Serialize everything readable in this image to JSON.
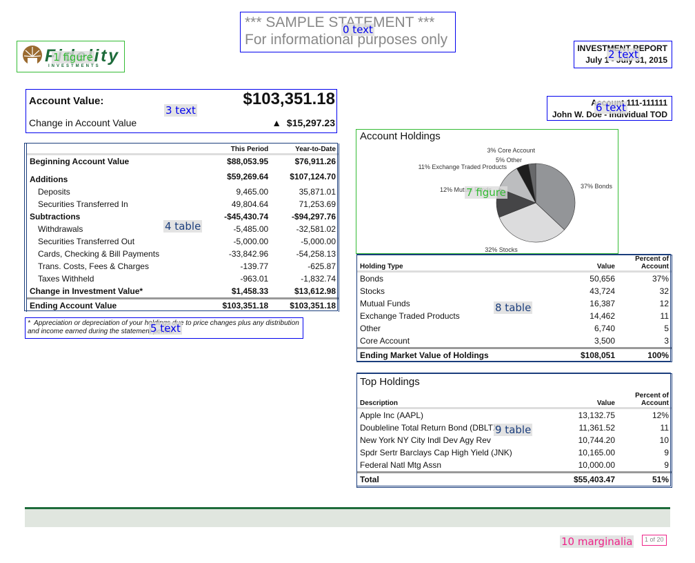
{
  "header": {
    "sample_line1": "*** SAMPLE STATEMENT ***",
    "sample_line2": "For informational purposes only",
    "report_title": "INVESTMENT REPORT",
    "report_period": "July 1 - July 31, 2015",
    "account_number": "Account 111-111111",
    "account_holder": "John W. Doe - Individual TOD",
    "logo_text": "Fidelity",
    "logo_sub": "INVESTMENTS"
  },
  "account_value": {
    "label": "Account Value:",
    "value": "$103,351.18",
    "change_label": "Change in Account Value",
    "change_arrow": "▲",
    "change_value": "$15,297.23"
  },
  "summary": {
    "columns": [
      "This Period",
      "Year-to-Date"
    ],
    "rows": [
      {
        "label": "Beginning Account Value",
        "p": "$88,053.95",
        "y": "$76,911.26"
      },
      {
        "label": "Additions",
        "p": "$59,269.64",
        "y": "$107,124.70"
      },
      {
        "label": "Deposits",
        "p": "9,465.00",
        "y": "35,871.01"
      },
      {
        "label": "Securities Transferred In",
        "p": "49,804.64",
        "y": "71,253.69"
      },
      {
        "label": "Subtractions",
        "p": "-$45,430.74",
        "y": "-$94,297.76"
      },
      {
        "label": "Withdrawals",
        "p": "-5,485.00",
        "y": "-32,581.02"
      },
      {
        "label": "Securities Transferred Out",
        "p": "-5,000.00",
        "y": "-5,000.00"
      },
      {
        "label": "Cards, Checking & Bill Payments",
        "p": "-33,842.96",
        "y": "-54,258.13"
      },
      {
        "label": "Trans. Costs, Fees & Charges",
        "p": "-139.77",
        "y": "-625.87"
      },
      {
        "label": "Taxes Withheld",
        "p": "-963.01",
        "y": "-1,832.74"
      },
      {
        "label": "Change in Investment Value*",
        "p": "$1,458.33",
        "y": "$13,612.98"
      },
      {
        "label": "Ending Account Value",
        "p": "$103,351.18",
        "y": "$103,351.18"
      }
    ],
    "footnote_mark": "*",
    "footnote": "Appreciation or depreciation of your holdings due to price changes plus any distribution and income earned during the statement period."
  },
  "holdings_chart": {
    "title": "Account Holdings",
    "slices": [
      {
        "label": "37% Bonds",
        "pct": 37,
        "color": "#939598"
      },
      {
        "label": "32% Stocks",
        "pct": 32,
        "color": "#dcdcdd"
      },
      {
        "label": "12% Mutual Funds",
        "pct": 12,
        "color": "#454547"
      },
      {
        "label": "11% Exchange Traded Products",
        "pct": 11,
        "color": "#bcbdbf"
      },
      {
        "label": "5% Other",
        "pct": 5,
        "color": "#1e1e1e"
      },
      {
        "label": "3% Core Account",
        "pct": 3,
        "color": "#68696b"
      }
    ]
  },
  "holdings_table": {
    "columns": [
      "Holding Type",
      "Value",
      "Percent of Account"
    ],
    "rows": [
      [
        "Bonds",
        "50,656",
        "37%"
      ],
      [
        "Stocks",
        "43,724",
        "32"
      ],
      [
        "Mutual Funds",
        "16,387",
        "12"
      ],
      [
        "Exchange Traded Products",
        "14,462",
        "11"
      ],
      [
        "Other",
        "6,740",
        "5"
      ],
      [
        "Core Account",
        "3,500",
        "3"
      ]
    ],
    "total": [
      "Ending Market Value of Holdings",
      "$108,051",
      "100%"
    ]
  },
  "top_holdings": {
    "title": "Top Holdings",
    "columns": [
      "Description",
      "Value",
      "Percent of Account"
    ],
    "rows": [
      [
        "Apple Inc (AAPL)",
        "13,132.75",
        "12%"
      ],
      [
        "Doubleline Total Return Bond (DBLTX)",
        "11,361.52",
        "11"
      ],
      [
        "New York NY City Indl Dev Agy Rev",
        "10,744.20",
        "10"
      ],
      [
        "Spdr Sertr Barclays Cap High Yield (JNK)",
        "10,165.00",
        "9"
      ],
      [
        "Federal Natl Mtg Assn",
        "10,000.00",
        "9"
      ]
    ],
    "total": [
      "Total",
      "$55,403.47",
      "51%"
    ]
  },
  "page_number": "1 of 20",
  "annotations": [
    {
      "label": "0 text",
      "color": "#0000ee"
    },
    {
      "label": "1 figure",
      "color": "#33bb33"
    },
    {
      "label": "2 text",
      "color": "#0000ee"
    },
    {
      "label": "3 text",
      "color": "#0000ee"
    },
    {
      "label": "4 table",
      "color": "#1a3d7c"
    },
    {
      "label": "5 text",
      "color": "#0000ee"
    },
    {
      "label": "6 text",
      "color": "#0000ee"
    },
    {
      "label": "7 figure",
      "color": "#33bb33"
    },
    {
      "label": "8 table",
      "color": "#1a3d7c"
    },
    {
      "label": "9 table",
      "color": "#1a3d7c"
    },
    {
      "label": "10 marginalia",
      "color": "#ee2288"
    }
  ]
}
